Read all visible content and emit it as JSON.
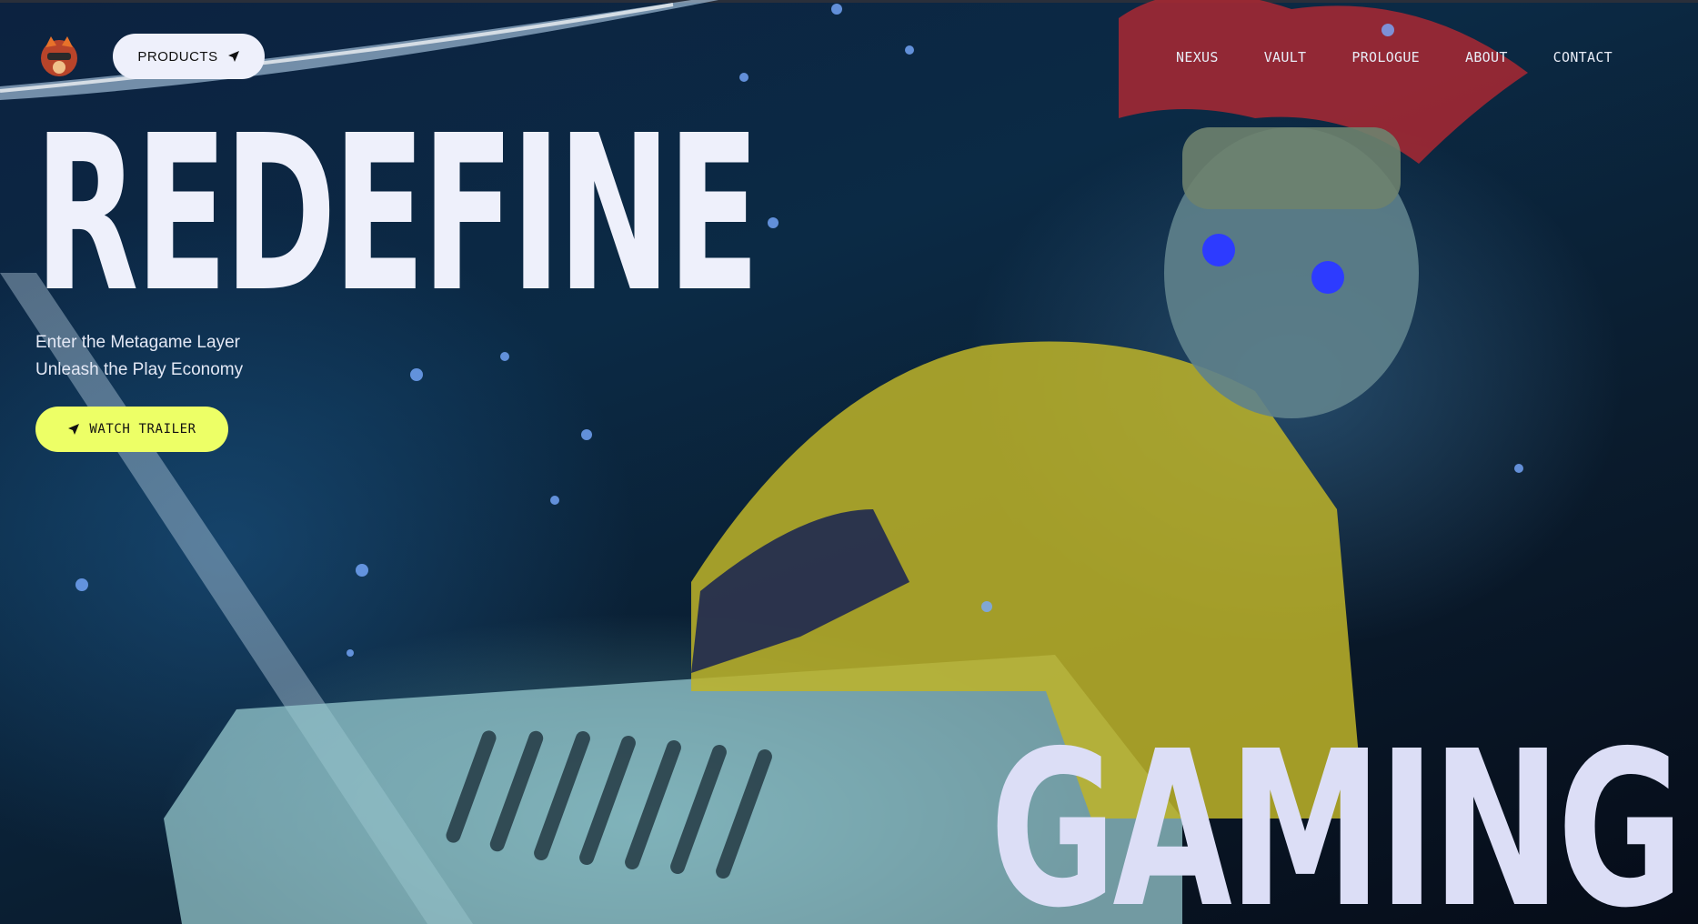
{
  "header": {
    "logo_icon": "fox-mascot-logo-icon",
    "products_label": "PRODUCTS",
    "nav": [
      {
        "label": "NEXUS"
      },
      {
        "label": "VAULT"
      },
      {
        "label": "PROLOGUE"
      },
      {
        "label": "ABOUT"
      },
      {
        "label": "CONTACT"
      }
    ]
  },
  "hero": {
    "title_top": "REDEFINE",
    "subtitle_line1": "Enter the Metagame Layer",
    "subtitle_line2": "Unleash the Play Economy",
    "cta_label": "WATCH TRAILER",
    "cta_icon": "send-arrow-icon",
    "title_bottom": "GAMING",
    "background": "animated-character-video-frame"
  },
  "colors": {
    "accent_yellow": "#edff66",
    "button_light": "#eef0fb",
    "title_text": "#eef0fb"
  }
}
